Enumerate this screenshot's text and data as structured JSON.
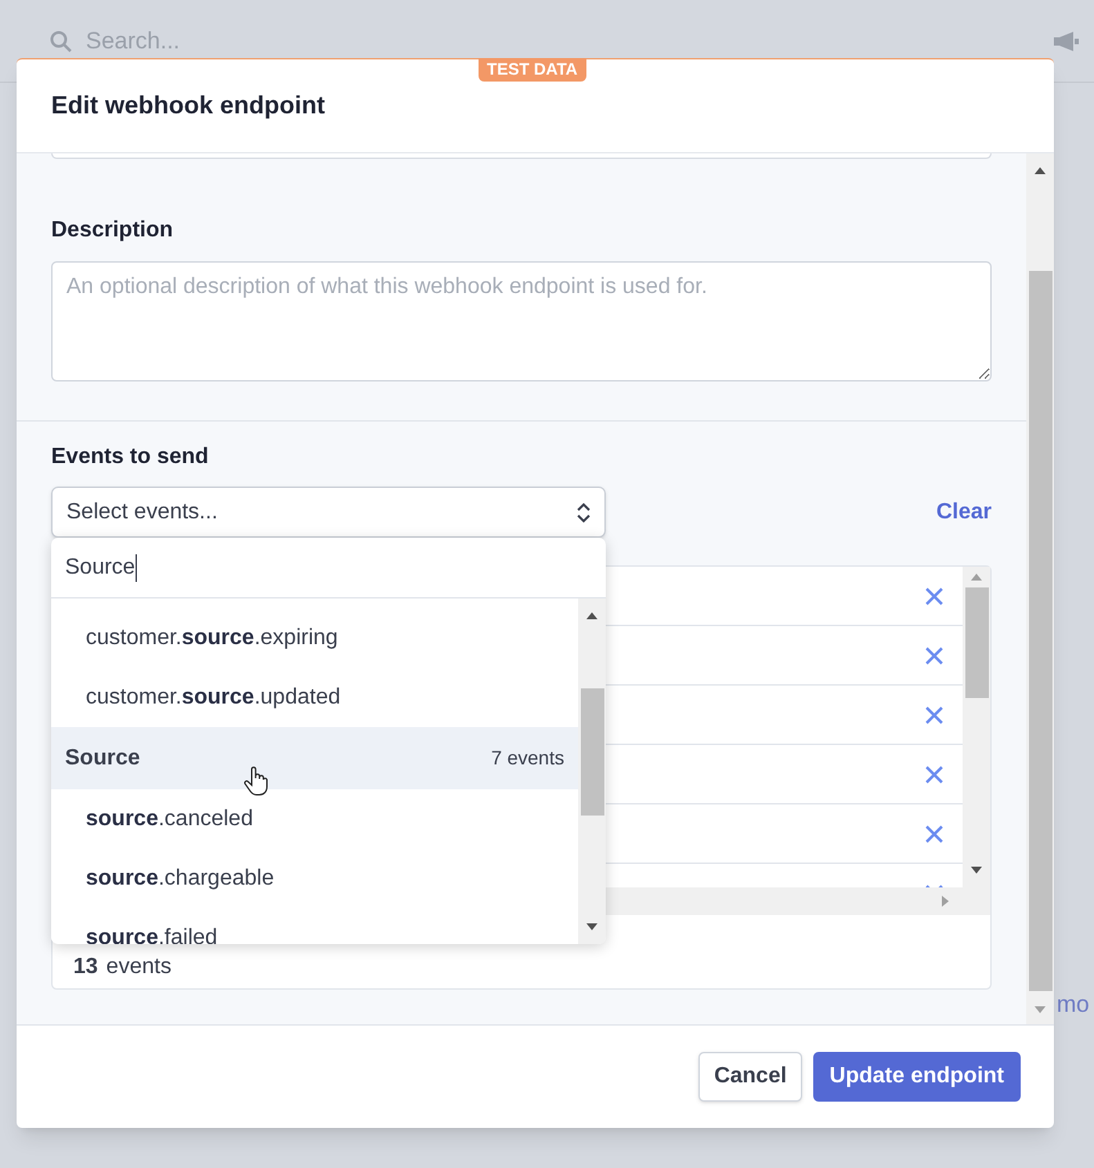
{
  "background": {
    "search_placeholder": "Search...",
    "side_text": "mo"
  },
  "modal": {
    "badge": "TEST DATA",
    "title": "Edit webhook endpoint",
    "description": {
      "label": "Description",
      "placeholder": "An optional description of what this webhook endpoint is used for."
    },
    "events": {
      "label": "Events to send",
      "select_placeholder": "Select events...",
      "clear": "Clear",
      "count": "13",
      "count_unit": "events",
      "dropdown": {
        "search_value": "Source",
        "items": [
          {
            "kind": "option",
            "label": "customer.**source**.expiring",
            "highlighted": false
          },
          {
            "kind": "option",
            "label": "customer.**source**.updated",
            "highlighted": false
          },
          {
            "kind": "group",
            "label": "Source",
            "count": "7 events",
            "highlighted": true
          },
          {
            "kind": "option",
            "label": "**source**.canceled",
            "highlighted": false
          },
          {
            "kind": "option",
            "label": "**source**.chargeable",
            "highlighted": false
          },
          {
            "kind": "option",
            "label": "**source**.failed",
            "highlighted": false
          }
        ]
      }
    },
    "buttons": [
      {
        "kind": "secondary",
        "label": "Cancel"
      },
      {
        "kind": "primary",
        "label": "Update endpoint"
      }
    ]
  }
}
